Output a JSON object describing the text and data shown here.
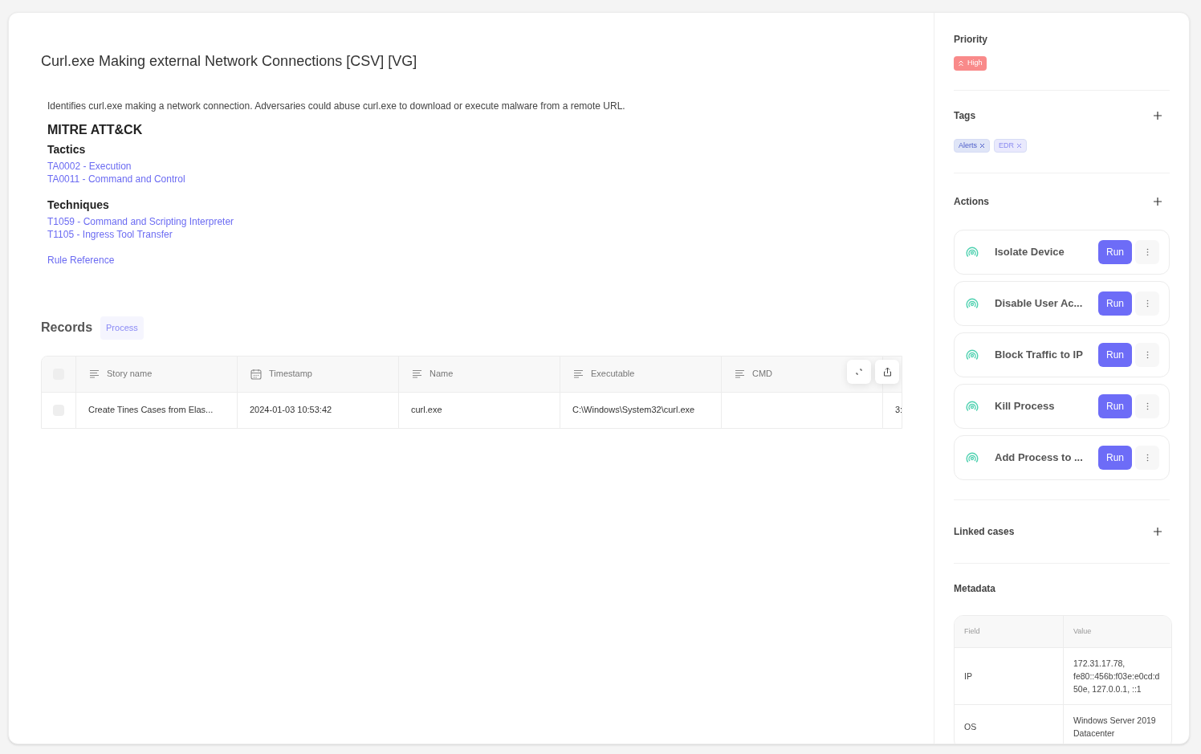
{
  "title": "Curl.exe Making external Network Connections [CSV] [VG]",
  "description": "Identifies curl.exe making a network connection. Adversaries could abuse curl.exe to download or execute malware from a remote URL.",
  "mitre": {
    "heading": "MITRE ATT&CK",
    "tactics_heading": "Tactics",
    "tactics": [
      "TA0002 - Execution",
      "TA0011 - Command and Control"
    ],
    "techniques_heading": "Techniques",
    "techniques": [
      "T1059 - Command and Scripting Interpreter",
      "T1105 - Ingress Tool Transfer"
    ],
    "reference": "Rule Reference"
  },
  "records": {
    "heading": "Records",
    "badge": "Process",
    "all_selected": false,
    "columns": [
      {
        "label": "Story name",
        "kind": "text"
      },
      {
        "label": "Timestamp",
        "kind": "date"
      },
      {
        "label": "Name",
        "kind": "text"
      },
      {
        "label": "Executable",
        "kind": "text"
      },
      {
        "label": "CMD",
        "kind": "text"
      }
    ],
    "rows": [
      {
        "checked": false,
        "cells": [
          "Create Tines Cases from Elas...",
          "2024-01-03 10:53:42",
          "curl.exe",
          "C:\\Windows\\System32\\curl.exe",
          "",
          "3:"
        ]
      }
    ]
  },
  "sidebar": {
    "priority": {
      "heading": "Priority",
      "label": "High"
    },
    "tags": {
      "heading": "Tags",
      "items": [
        {
          "label": "Alerts",
          "color": "#dfe5f7"
        },
        {
          "label": "EDR",
          "color": "#e9e9fd"
        }
      ]
    },
    "actions": {
      "heading": "Actions",
      "items": [
        {
          "label": "Isolate Device",
          "button": "Run"
        },
        {
          "label": "Disable User Ac...",
          "button": "Run"
        },
        {
          "label": "Block Traffic to IP",
          "button": "Run"
        },
        {
          "label": "Kill Process",
          "button": "Run"
        },
        {
          "label": "Add Process to ...",
          "button": "Run"
        }
      ]
    },
    "linked_cases": {
      "heading": "Linked cases"
    },
    "metadata": {
      "heading": "Metadata",
      "columns": [
        "Field",
        "Value"
      ],
      "rows": [
        [
          "IP",
          "172.31.17.78, fe80::456b:f03e:e0cd:d50e, 127.0.0.1, ::1"
        ],
        [
          "OS",
          "Windows Server 2019 Datacenter"
        ]
      ]
    }
  }
}
